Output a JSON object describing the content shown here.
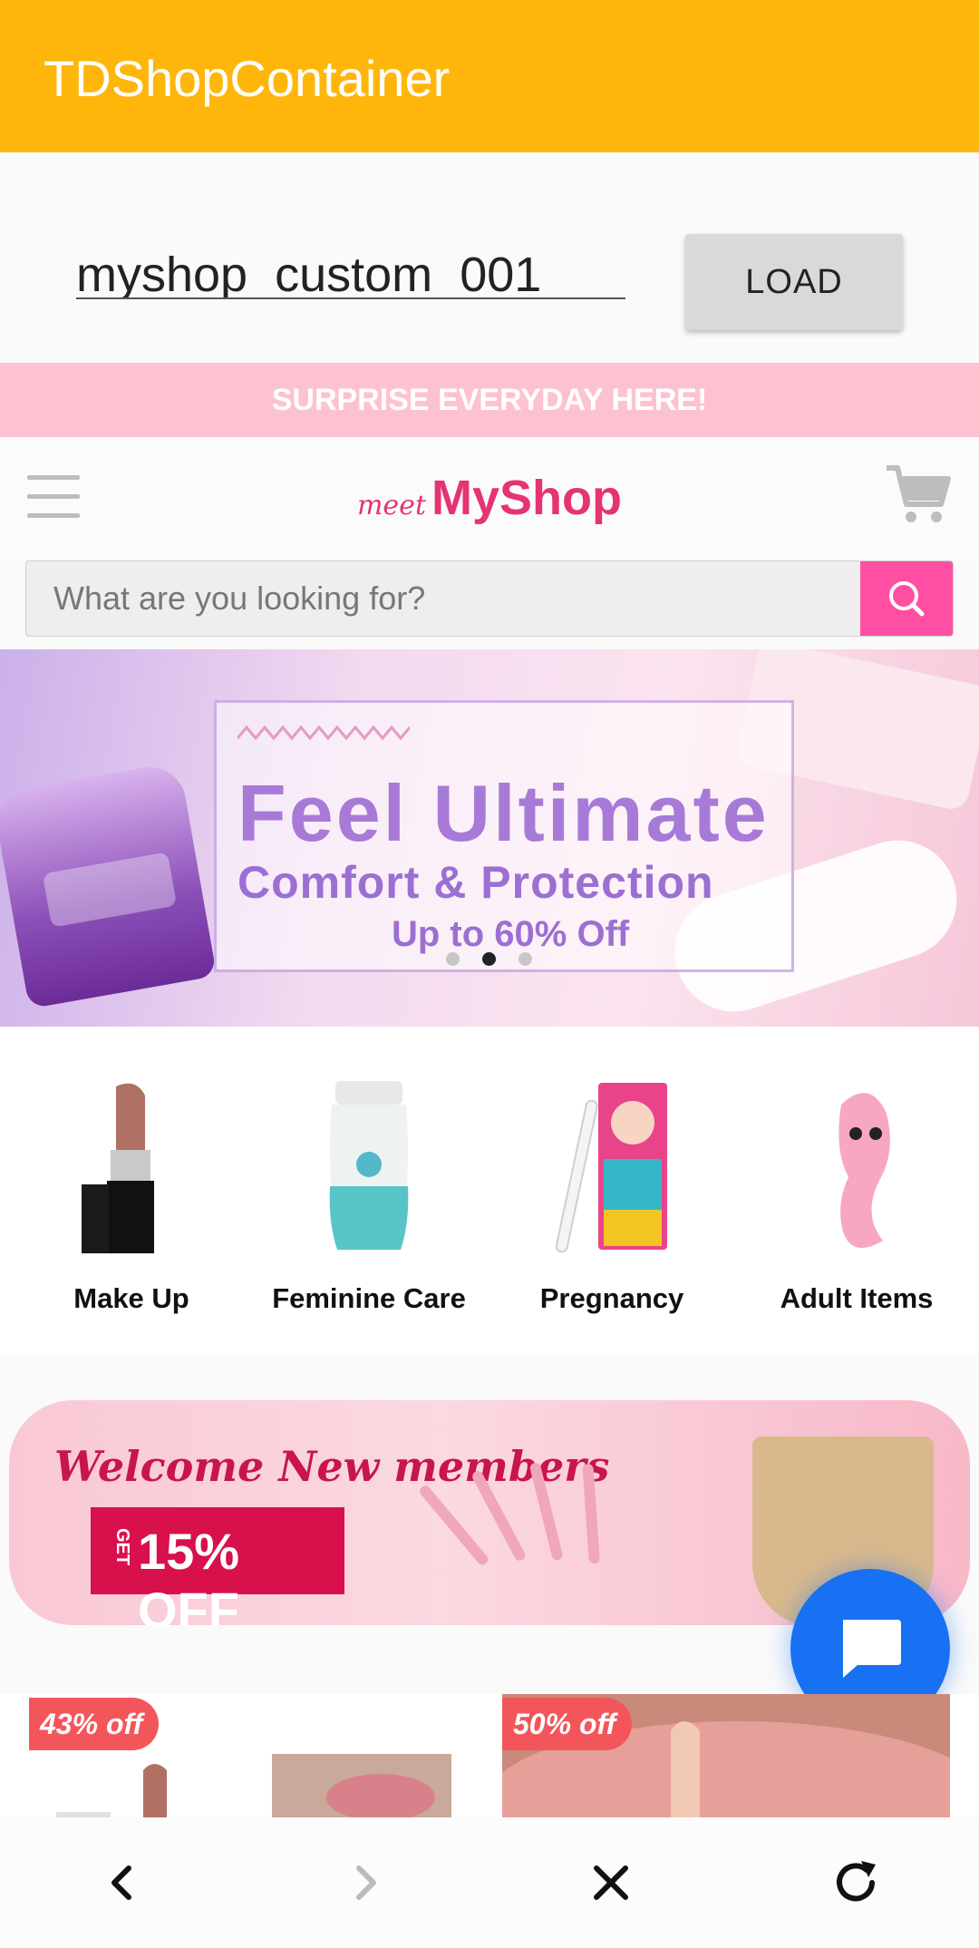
{
  "appbar": {
    "title": "TDShopContainer",
    "color": "#FFB60A"
  },
  "loader": {
    "shop_id_value": "myshop_custom_001",
    "load_label": "LOAD"
  },
  "promo": {
    "text": "SURPRISE EVERYDAY HERE!"
  },
  "header": {
    "menu_icon": "hamburger-menu-icon",
    "logo_prefix": "meet",
    "logo_brand": "MyShop",
    "cart_icon": "shopping-cart-icon",
    "brand_color": "#E53374"
  },
  "search": {
    "placeholder": "What are you looking for?",
    "button_icon": "search-icon",
    "button_color": "#FF4FA3"
  },
  "banner": {
    "headline": "Feel Ultimate",
    "subheadline": "Comfort & Protection",
    "offer": "Up to 60% Off",
    "slide_count": 3,
    "active_slide": 2
  },
  "categories": [
    {
      "label": "Make Up",
      "icon": "lipstick-icon"
    },
    {
      "label": "Feminine Care",
      "icon": "wash-bottle-icon"
    },
    {
      "label": "Pregnancy",
      "icon": "pregnancy-test-icon"
    },
    {
      "label": "Adult Items",
      "icon": "toy-icon"
    }
  ],
  "welcome_banner": {
    "title": "Welcome New members",
    "get": "GET",
    "discount": "15% OFF"
  },
  "chat": {
    "icon": "chat-bubble-icon",
    "color": "#1870F2"
  },
  "products": [
    {
      "badge": "43% off"
    },
    {
      "badge": ""
    },
    {
      "badge": "50% off"
    }
  ],
  "nav": {
    "back_icon": "back-arrow-icon",
    "forward_icon": "forward-arrow-icon",
    "close_icon": "close-icon",
    "reload_icon": "reload-icon"
  }
}
